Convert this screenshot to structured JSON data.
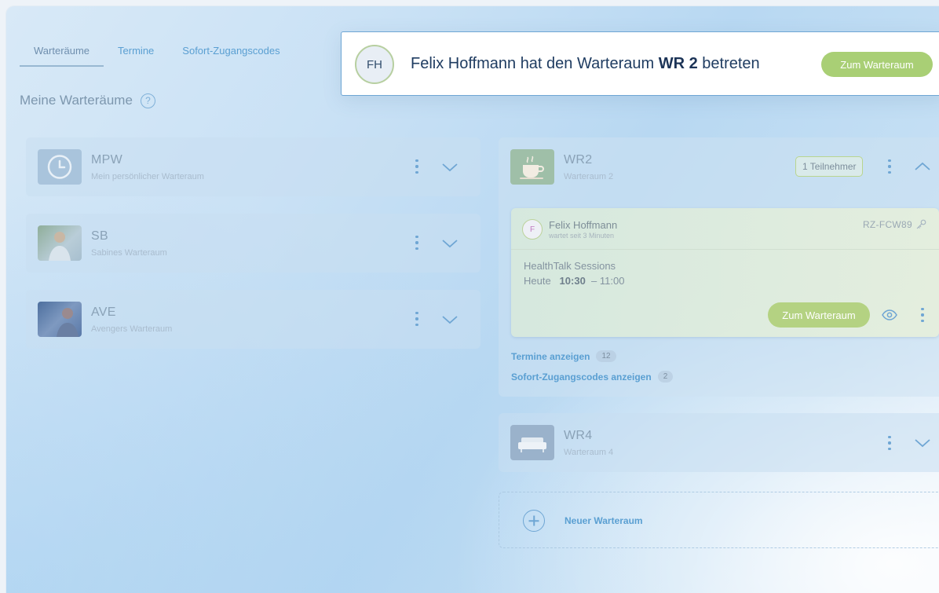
{
  "tabs": [
    {
      "label": "Warteräume"
    },
    {
      "label": "Termine"
    },
    {
      "label": "Sofort-Zugangscodes"
    }
  ],
  "section": {
    "title": "Meine Warteräume",
    "help": "?"
  },
  "rooms_left": [
    {
      "name": "MPW",
      "subtitle": "Mein persönlicher Warteraum"
    },
    {
      "name": "SB",
      "subtitle": "Sabines Warteraum"
    },
    {
      "name": "AVE",
      "subtitle": "Avengers Warteraum"
    }
  ],
  "wr2": {
    "name": "WR2",
    "subtitle": "Warteraum 2",
    "badge": "1 Teilnehmer",
    "participant": {
      "initial": "F",
      "name": "Felix Hoffmann",
      "waiting": "wartet seit 3 Minuten",
      "code": "RZ-FCW89",
      "session": "HealthTalk Sessions",
      "day": "Heute",
      "start": "10:30",
      "end": "– 11:00",
      "button": "Zum Warteraum"
    },
    "links": [
      {
        "label": "Termine anzeigen",
        "count": "12"
      },
      {
        "label": "Sofort-Zugangscodes anzeigen",
        "count": "2"
      }
    ]
  },
  "wr4": {
    "name": "WR4",
    "subtitle": "Warteraum 4"
  },
  "new_room": {
    "label": "Neuer Warteraum"
  },
  "notification": {
    "initials": "FH",
    "text_before": "Felix Hoffmann hat den Warteraum ",
    "room": "WR 2",
    "text_after": " betreten",
    "button": "Zum Warteraum"
  },
  "colors": {
    "accent": "#5a9fd2",
    "button_green": "#a9cf75",
    "popup_border": "#6fa6d4"
  }
}
